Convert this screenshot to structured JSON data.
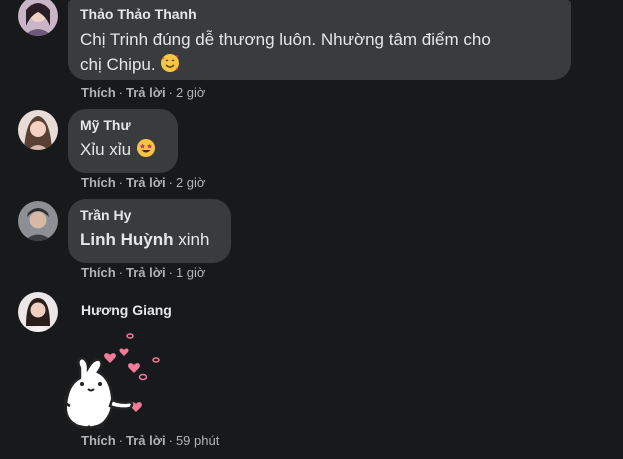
{
  "comments": [
    {
      "author": "Thảo Thảo Thanh",
      "text_line1": "Chị Trinh đúng dễ thương luôn. Nhường tâm điểm cho",
      "text_line2": "chị Chipu.",
      "emoji": "smiling-face-with-hearts",
      "like": "Thích",
      "reply": "Trả lời",
      "time": "2 giờ"
    },
    {
      "author": "Mỹ Thư",
      "text": "Xỉu xỉu",
      "emoji": "star-struck",
      "like": "Thích",
      "reply": "Trả lời",
      "time": "2 giờ"
    },
    {
      "author": "Trần Hy",
      "mention": "Linh Huỳnh",
      "text": "xinh",
      "like": "Thích",
      "reply": "Trả lời",
      "time": "1 giờ"
    },
    {
      "author": "Hương Giang",
      "sticker": "bunny-sending-hearts-sticker",
      "like": "Thích",
      "reply": "Trả lời",
      "time": "59 phút"
    }
  ],
  "separator": "·",
  "colors": {
    "background": "#18191a",
    "bubble": "#3a3b3c",
    "text": "#e4e6eb",
    "secondary": "#b0b3b8",
    "heart": "#f27a9a"
  }
}
